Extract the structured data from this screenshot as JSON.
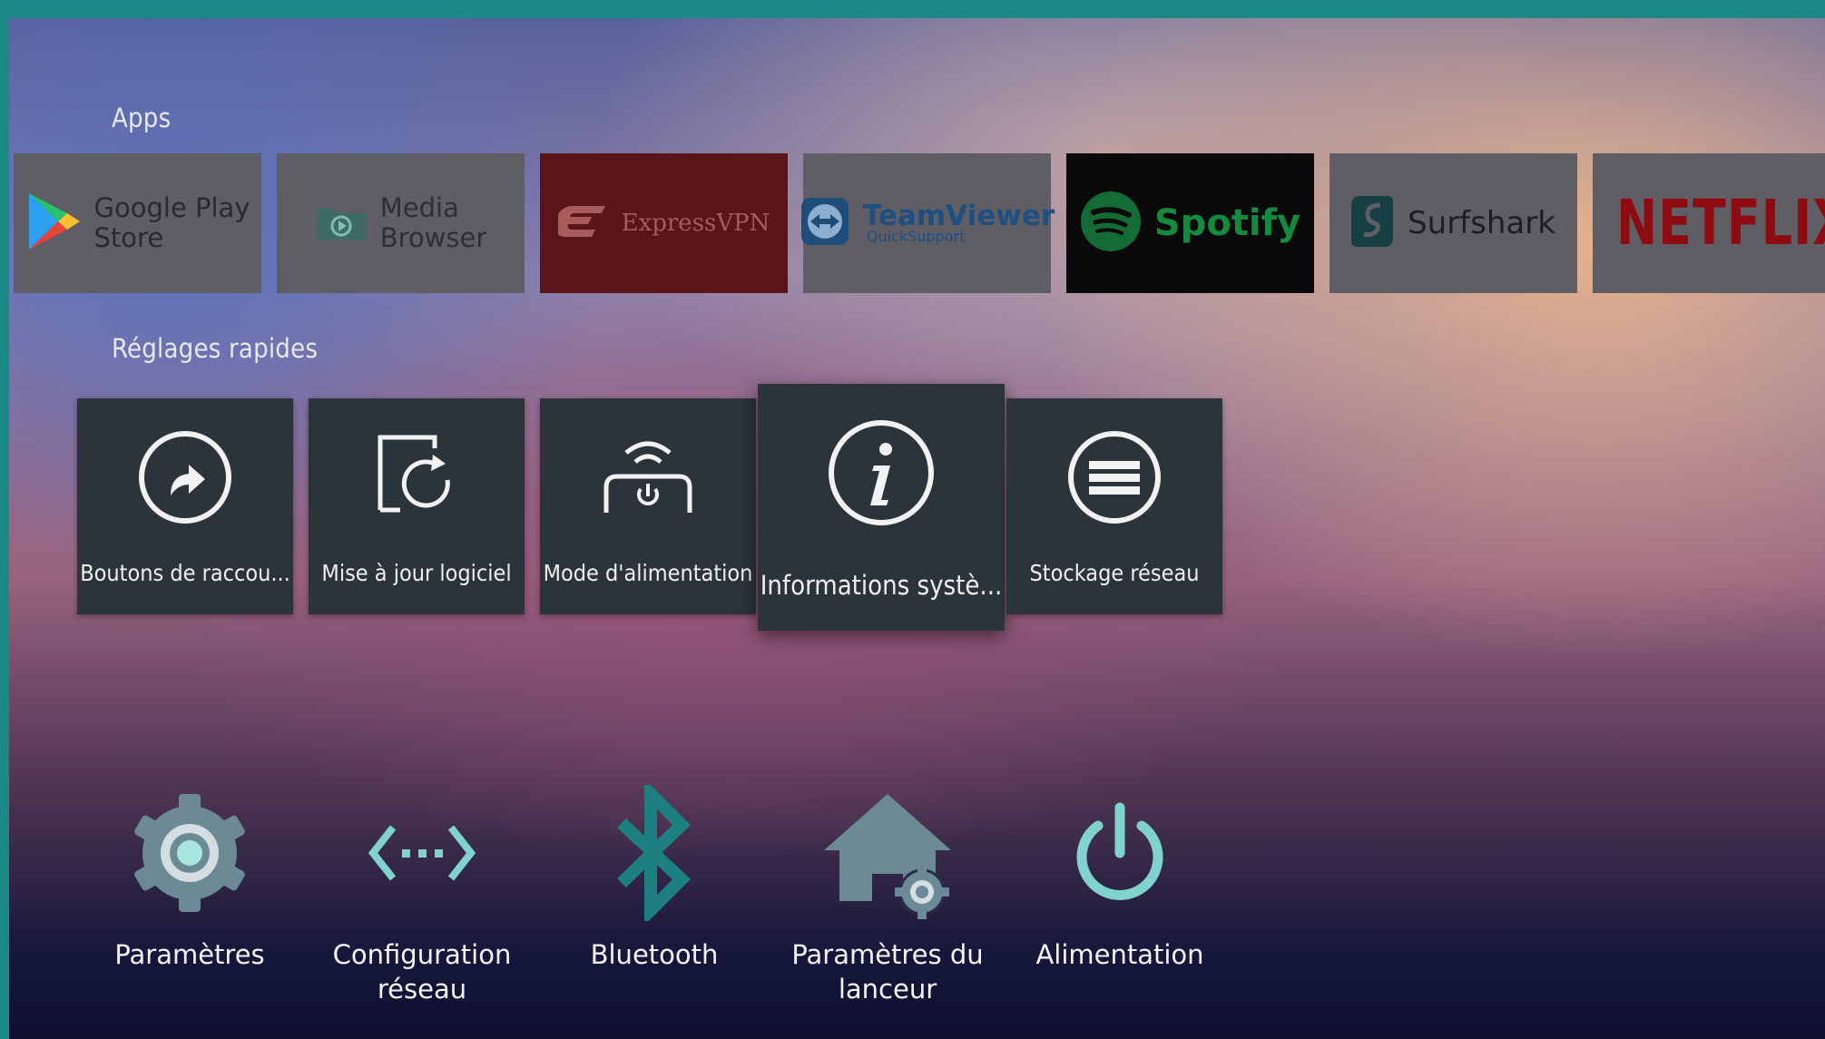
{
  "sections": {
    "apps_title": "Apps",
    "quick_settings_title": "Réglages rapides"
  },
  "apps": [
    {
      "name_line1": "Google Play",
      "name_line2": "Store",
      "icon": "google-play-icon"
    },
    {
      "name_line1": "Media",
      "name_line2": "Browser",
      "icon": "folder-play-icon"
    },
    {
      "name": "ExpressVPN",
      "icon": "expressvpn-logo"
    },
    {
      "name_main": "TeamViewer",
      "name_sub": "QuickSupport",
      "icon": "teamviewer-logo"
    },
    {
      "name": "Spotify",
      "icon": "spotify-logo"
    },
    {
      "name": "Surfshark",
      "icon": "surfshark-logo"
    },
    {
      "name": "NETFLIX",
      "icon": "netflix-logo"
    }
  ],
  "quick_settings": [
    {
      "label": "Boutons de raccou...",
      "icon": "shortcut-arrow-icon"
    },
    {
      "label": "Mise à jour logiciel",
      "icon": "software-update-icon"
    },
    {
      "label": "Mode d'alimentation",
      "icon": "power-mode-icon"
    },
    {
      "label": "Informations systè...",
      "icon": "info-icon",
      "focused": true
    },
    {
      "label": "Stockage réseau",
      "icon": "network-storage-icon"
    }
  ],
  "settings": [
    {
      "label_line1": "Paramètres",
      "label_line2": "",
      "icon": "gear-icon"
    },
    {
      "label_line1": "Configuration",
      "label_line2": "réseau",
      "icon": "network-arrows-icon"
    },
    {
      "label_line1": "Bluetooth",
      "label_line2": "",
      "icon": "bluetooth-icon"
    },
    {
      "label_line1": "Paramètres du",
      "label_line2": "lanceur",
      "icon": "home-gear-icon"
    },
    {
      "label_line1": "Alimentation",
      "label_line2": "",
      "icon": "power-icon"
    }
  ],
  "colors": {
    "accent_teal": "#7fd3cc",
    "bluetooth_teal": "#1d7f80",
    "tile_dark": "#2a3439",
    "tile_grey": "#5d5d63",
    "expressvpn_red": "#5a1519",
    "spotify_green": "#1db954",
    "netflix_red": "#b1060f"
  }
}
